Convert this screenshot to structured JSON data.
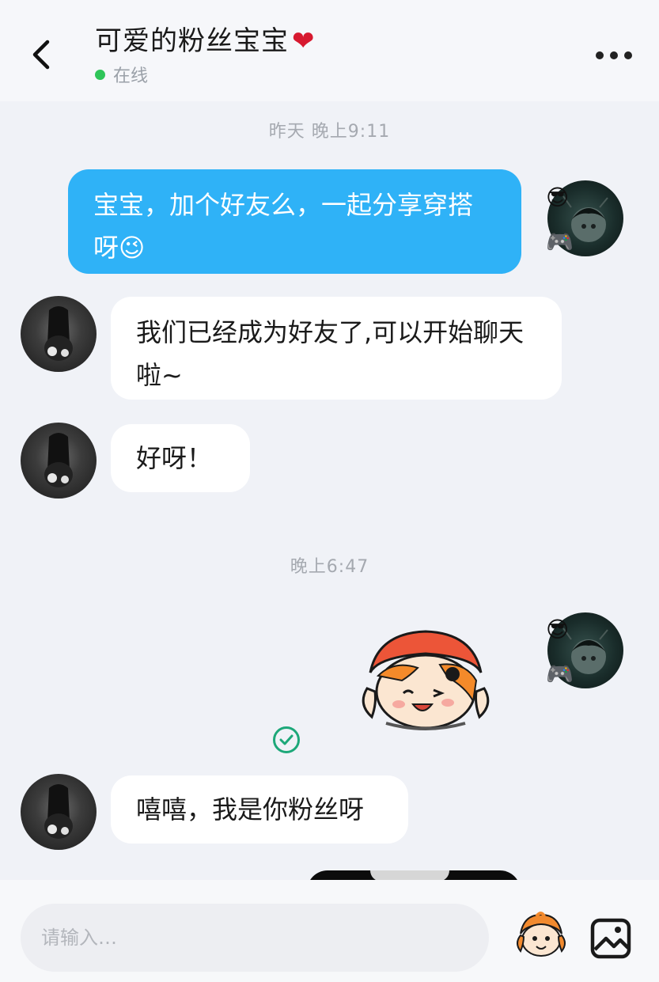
{
  "header": {
    "title": "可爱的粉丝宝宝",
    "title_suffix": "❤",
    "status": "在线"
  },
  "timestamps": [
    "昨天 晚上9:11",
    "晚上6:47"
  ],
  "messages": [
    {
      "from": "me",
      "text": "宝宝，加个好友么，一起分享穿搭呀😉"
    },
    {
      "from": "them",
      "text": "我们已经成为好友了,可以开始聊天啦~"
    },
    {
      "from": "them",
      "text": "好呀！"
    },
    {
      "from": "me",
      "type": "sticker"
    },
    {
      "from": "them",
      "text": "嘻嘻，我是你粉丝呀"
    }
  ],
  "avatar_badges": {
    "top": "😎",
    "bottom": "🎮"
  },
  "input": {
    "placeholder": "请输入…"
  },
  "colors": {
    "my_bubble": "#2fb2f7",
    "their_bubble": "#ffffff",
    "online_dot": "#2fc559",
    "read_check": "#1da879",
    "background": "#f0f2f7"
  },
  "icons": [
    "back-arrow-icon",
    "more-dots-icon",
    "read-check-icon",
    "emoji-sticker-icon",
    "image-icon"
  ]
}
